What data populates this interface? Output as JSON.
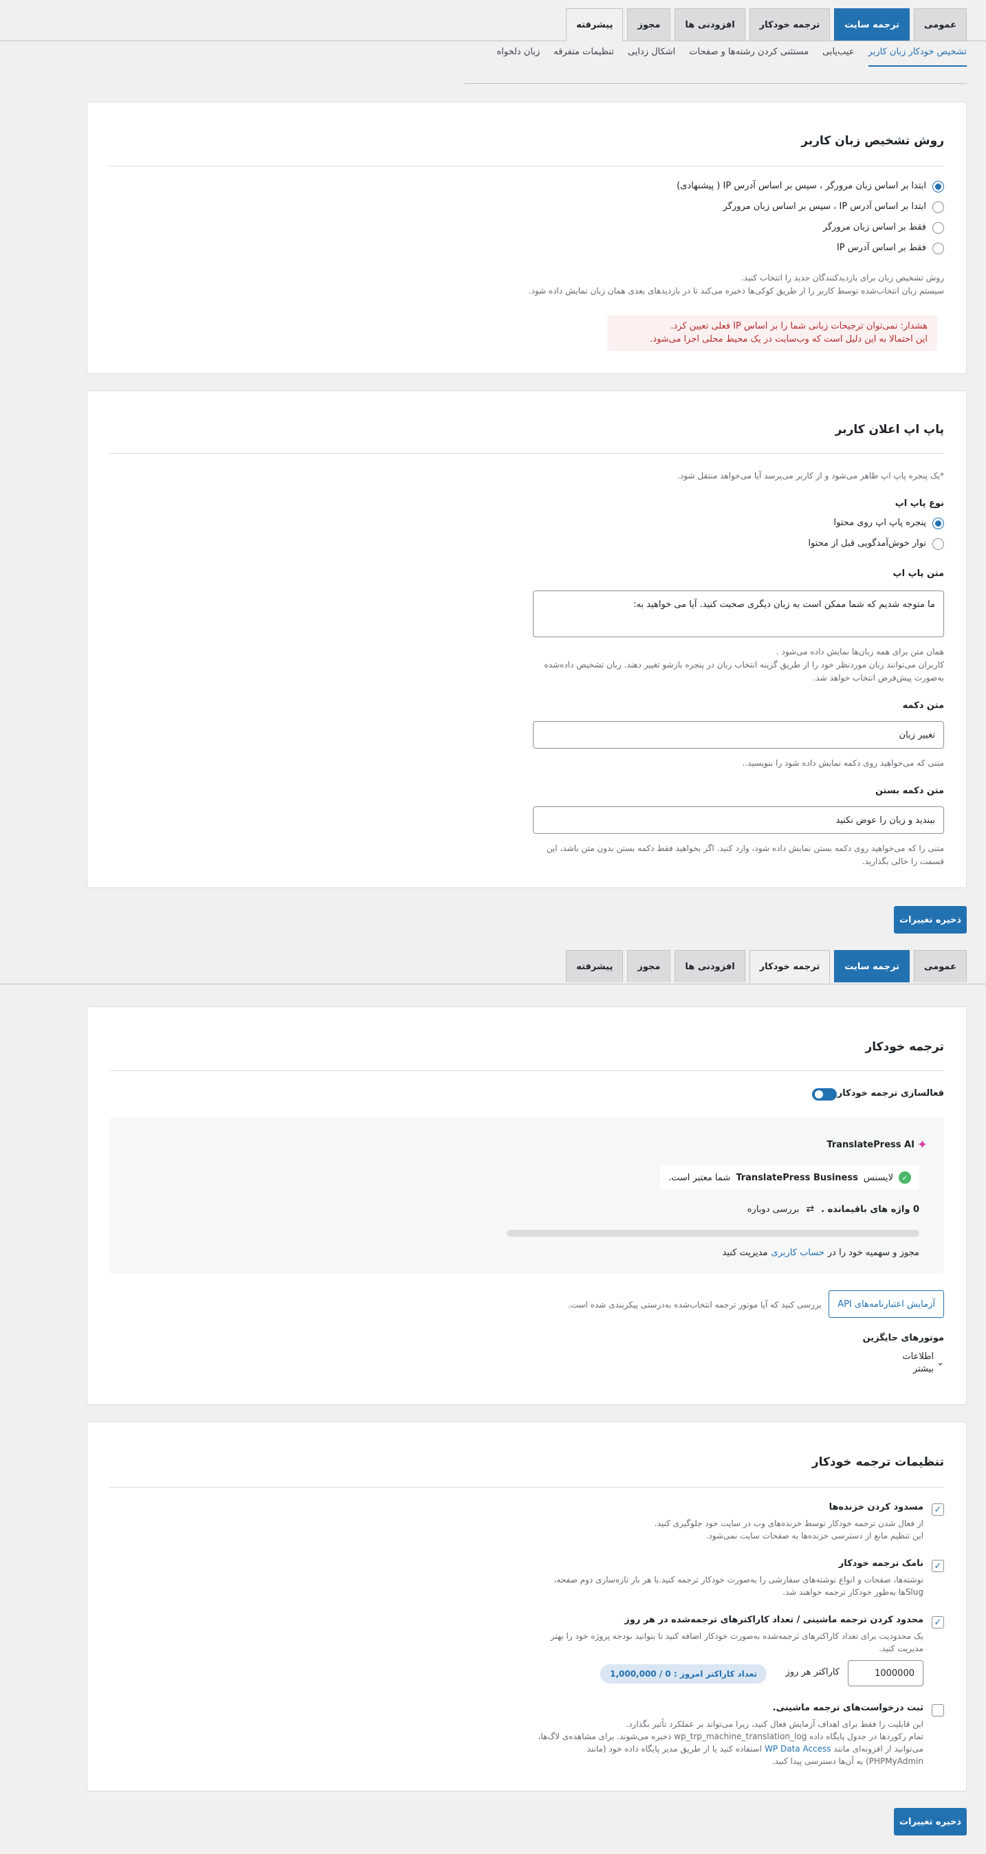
{
  "tabs_top": [
    "عمومی",
    "ترجمه سایت",
    "ترجمه خودکار",
    "افزودنی ها",
    "مجوز",
    "پیشرفته"
  ],
  "subnav": [
    "تشخیص خودکار زبان کاربر",
    "عیب‌یابی",
    "مستثنی کردن رشته‌ها و صفحات",
    "اشکال زدایی",
    "تنظیمات متفرقه",
    "زبان دلخواه"
  ],
  "detect": {
    "title": "روش تشخیص زبان کاربر",
    "options": [
      "ابتدا بر اساس زبان مرورگر ، سپس بر اساس آدرس IP ( پیشنهادی)",
      "ابتدا بر اساس آدرس IP ، سپس بر اساس زبان مرورگر",
      "فقط بر اساس زبان مرورگر",
      "فقط بر اساس آدرس IP"
    ],
    "desc1": "روش تشخیص زبان برای بازدیدکنندگان جدید را انتخاب کنید.",
    "desc2": "سیستم زبان انتخاب‌شده توسط کاربر را از طریق کوکی‌ها ذخیره می‌کند تا در بازدیدهای بعدی همان زبان نمایش داده شود.",
    "warning1": "هشدار: نمی‌توان ترجیحات زبانی شما را بر اساس IP فعلی تعیین کرد.",
    "warning2": "این احتمالا به این دلیل است که وب‌سایت در یک محیط محلی اجرا می‌شود."
  },
  "popup": {
    "title": "پاپ اپ اعلان کاربر",
    "intro": "*یک پنجره پاپ اپ ظاهر می‌شود و از کاربر می‌پرسد آیا می‌خواهد منتقل شود.",
    "type_label": "نوع پاپ اپ",
    "type_options": [
      "پنجره پاپ اپ روی محتوا",
      "نوار خوش‌آمدگویی قبل از محتوا"
    ],
    "text_label": "متن پاپ اپ",
    "text_value": "ما متوجه شدیم که شما ممکن است به زبان دیگری صحبت کنید. آیا می خواهید به:",
    "text_help1": "همان متن برای همه زبان‌ها نمایش داده می‌شود .",
    "text_help2": "کاربران می‌توانند زبان موردنظر خود را از طریق گزینه انتخاب زبان در پنجره بازشو تغییر دهند. زبان تشخیص داده‌شده",
    "text_help3": "به‌صورت پیش‌فرض انتخاب خواهد شد.",
    "button_label": "متن دکمه",
    "button_value": "تغییر زبان",
    "button_help": "متنی که می‌خواهید روی دکمه نمایش داده شود را بنویسید..",
    "close_label": "متن دکمه بستن",
    "close_value": "ببندید و زبان را عوض نکنید",
    "close_help1": "متنی را که می‌خواهید روی دکمه بستن نمایش داده شود، وارد کنید. اگر بخواهید فقط دکمه بستن بدون متن باشد، این",
    "close_help2": "قسمت را خالی بگذارید."
  },
  "save_label": "ذخیره تغییرات",
  "tabs_mid": [
    "عمومی",
    "ترجمه سایت",
    "ترجمه خودکار",
    "افزودنی ها",
    "مجوز",
    "پیشرفته"
  ],
  "auto": {
    "title": "ترجمه خودکار",
    "enable_label": "فعالسازی ترجمه خودکار",
    "brand": "TranslatePress AI",
    "license_pre": "لایسنس",
    "license_name": "TranslatePress Business",
    "license_post": "شما معتبر است.",
    "remaining": "0 واژه های باقیمانده .",
    "recheck": "بررسی دوباره",
    "manage_pre": "مجوز و سهمیه خود را در",
    "manage_link": "حساب کاربری",
    "manage_post": "مدیریت کنید",
    "test_btn": "آزمایش اعتبارنامه‌های API",
    "test_desc": "بررسی کنید که آیا موتور ترجمه انتخاب‌شده به‌درستی پیکربندی شده است.",
    "alt_title": "موتورهای جایگزین",
    "more1": "اطلاعات",
    "more2": "بیشتر"
  },
  "settings": {
    "title": "تنظیمات ترجمه خودکار",
    "items": [
      {
        "title": "مسدود کردن خزنده‌ها",
        "d1": "از فعال شدن ترجمه خودکار توسط خزنده‌های وب در سایت خود جلوگیری کنید.",
        "d2": "این تنظیم مانع از دسترسی خزنده‌ها به صفحات سایت نمی‌شود."
      },
      {
        "title": "نامک ترجمه خودکار",
        "d1": "نوشته‌ها، صفحات و انواع نوشته‌های سفارشی را به‌صورت خودکار ترجمه کنید.با هر بار تازه‌سازی دوم صفحه،",
        "d2": "Slugها به‌طور خودکار ترجمه خواهند شد."
      },
      {
        "title": "محدود کردن ترجمه ماشینی / تعداد کاراکترهای ترجمه‌شده در هر روز",
        "d1": "یک محدودیت برای تعداد کاراکترهای ترجمه‌شده به‌صورت خودکار اضافه کنید تا بتوانید بودجه پروژه خود را بهتر",
        "d2": "مدیریت کنید."
      },
      {
        "title": "ثبت درخواست‌های ترجمه ماشینی.",
        "d1": "این قابلیت را فقط برای اهداف آزمایش فعال کنید، زیرا می‌تواند بر عملکرد تأثیر بگذارد.",
        "d2": "تمام رکوردها در جدول پایگاه داده wp_trp_machine_translation_log ذخیره می‌شوند. برای مشاهده‌ی لاگ‌ها،",
        "d3_pre": "می‌توانید از افزونه‌ای مانند",
        "d3_link": "WP Data Access",
        "d3_post": "استفاده کنید یا از طریق مدیر پایگاه داده خود (مانند",
        "d4": "PHPMyAdmin) به آن‌ها دسترسی پیدا کنید."
      }
    ],
    "limit_value": "1000000",
    "limit_unit": "کاراکتر هر روز",
    "limit_badge": "تعداد کاراکتر امروز : 0 / 1,000,000"
  }
}
